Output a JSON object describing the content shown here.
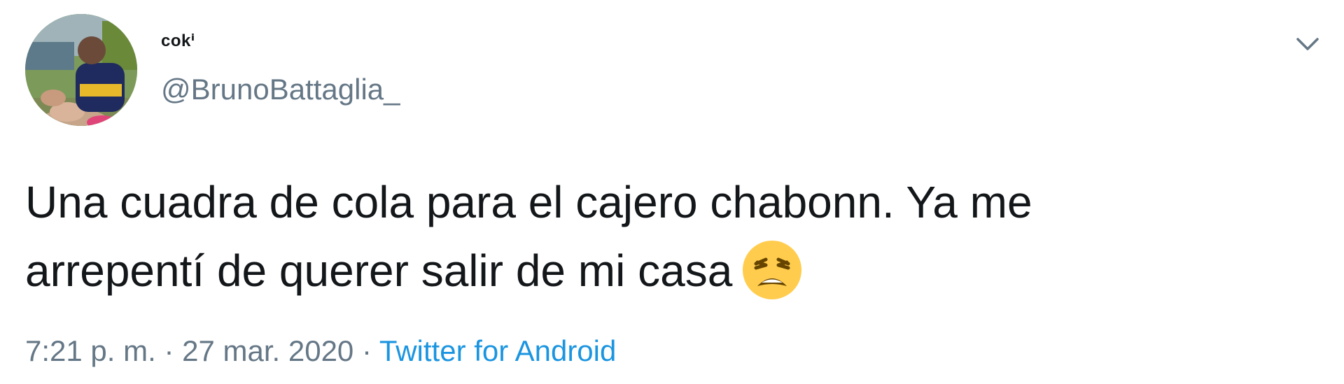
{
  "author": {
    "display_name": "cokⁱ",
    "handle": "@BrunoBattaglia_"
  },
  "tweet": {
    "text_line1": "Una cuadra de cola para el cajero chabonn. Ya me",
    "text_line2": "arrepentí de querer salir de mi casa",
    "emoji": "weary-face"
  },
  "meta": {
    "time": "7:21 p. m.",
    "separator": "·",
    "date": "27 mar. 2020",
    "source": "Twitter for Android"
  },
  "colors": {
    "text": "#14171a",
    "secondary": "#657786",
    "link": "#1b95e0"
  },
  "icons": {
    "caret": "chevron-down-icon"
  }
}
